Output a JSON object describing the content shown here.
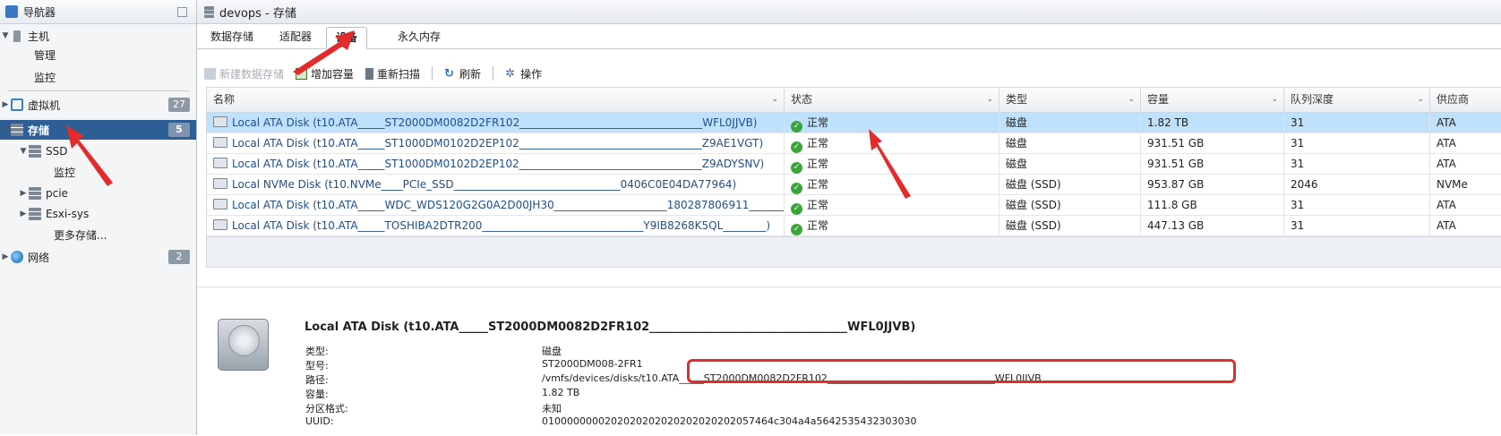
{
  "navigator": {
    "title": "导航器",
    "items": [
      {
        "label": "主机"
      },
      {
        "label": "管理"
      },
      {
        "label": "监控"
      },
      {
        "label": "虚拟机",
        "count": "27"
      },
      {
        "label": "存储",
        "count": "5"
      },
      {
        "label": "SSD"
      },
      {
        "label": "监控"
      },
      {
        "label": "pcie"
      },
      {
        "label": "Esxi-sys"
      },
      {
        "label": "更多存储..."
      },
      {
        "label": "网络",
        "count": "2"
      }
    ]
  },
  "main": {
    "title": "devops - 存储",
    "tabs": [
      "数据存储",
      "适配器",
      "设备",
      "永久内存"
    ],
    "active_tab": "设备",
    "toolbar": [
      "新建数据存储",
      "增加容量",
      "重新扫描",
      "刷新",
      "操作"
    ],
    "columns": [
      "名称",
      "状态",
      "类型",
      "容量",
      "队列深度",
      "供应商"
    ],
    "rows": [
      {
        "name": "Local ATA Disk (t10.ATA_____ST2000DM0082D2FR102__________________________________WFL0JJVB)",
        "status": "正常",
        "type": "磁盘",
        "capacity": "1.82 TB",
        "queue": "31",
        "vendor": "ATA"
      },
      {
        "name": "Local ATA Disk (t10.ATA_____ST1000DM0102D2EP102__________________________________Z9AE1VGT)",
        "status": "正常",
        "type": "磁盘",
        "capacity": "931.51 GB",
        "queue": "31",
        "vendor": "ATA"
      },
      {
        "name": "Local ATA Disk (t10.ATA_____ST1000DM0102D2EP102__________________________________Z9ADYSNV)",
        "status": "正常",
        "type": "磁盘",
        "capacity": "931.51 GB",
        "queue": "31",
        "vendor": "ATA"
      },
      {
        "name": "Local NVMe Disk (t10.NVMe____PCIe_SSD_______________________________0406C0E04DA77964)",
        "status": "正常",
        "type": "磁盘 (SSD)",
        "capacity": "953.87 GB",
        "queue": "2046",
        "vendor": "NVMe"
      },
      {
        "name": "Local ATA Disk (t10.ATA_____WDC_WDS120G2G0A2D00JH30_____________________180287806911________)",
        "status": "正常",
        "type": "磁盘 (SSD)",
        "capacity": "111.8 GB",
        "queue": "31",
        "vendor": "ATA"
      },
      {
        "name": "Local ATA Disk (t10.ATA_____TOSHIBA2DTR200______________________________Y9IB8268K5QL________)",
        "status": "正常",
        "type": "磁盘 (SSD)",
        "capacity": "447.13 GB",
        "queue": "31",
        "vendor": "ATA"
      }
    ],
    "selected_row": 0,
    "detail": {
      "title": "Local ATA Disk (t10.ATA_____ST2000DM0082D2FR102__________________________________WFL0JJVB)",
      "fields": [
        {
          "label": "类型:",
          "value": "磁盘"
        },
        {
          "label": "型号:",
          "value": "ST2000DM008-2FR1"
        },
        {
          "label": "路径:",
          "value": "/vmfs/devices/disks/t10.ATA_____ST2000DM0082D2FR102__________________________________WFL0JJVB"
        },
        {
          "label": "容量:",
          "value": "1.82 TB"
        },
        {
          "label": "分区格式:",
          "value": "未知"
        },
        {
          "label": "UUID:",
          "value": "0100000000202020202020202020202057464c304a4a5642535432303030"
        }
      ]
    }
  },
  "annotation_color": "#e42b2b"
}
